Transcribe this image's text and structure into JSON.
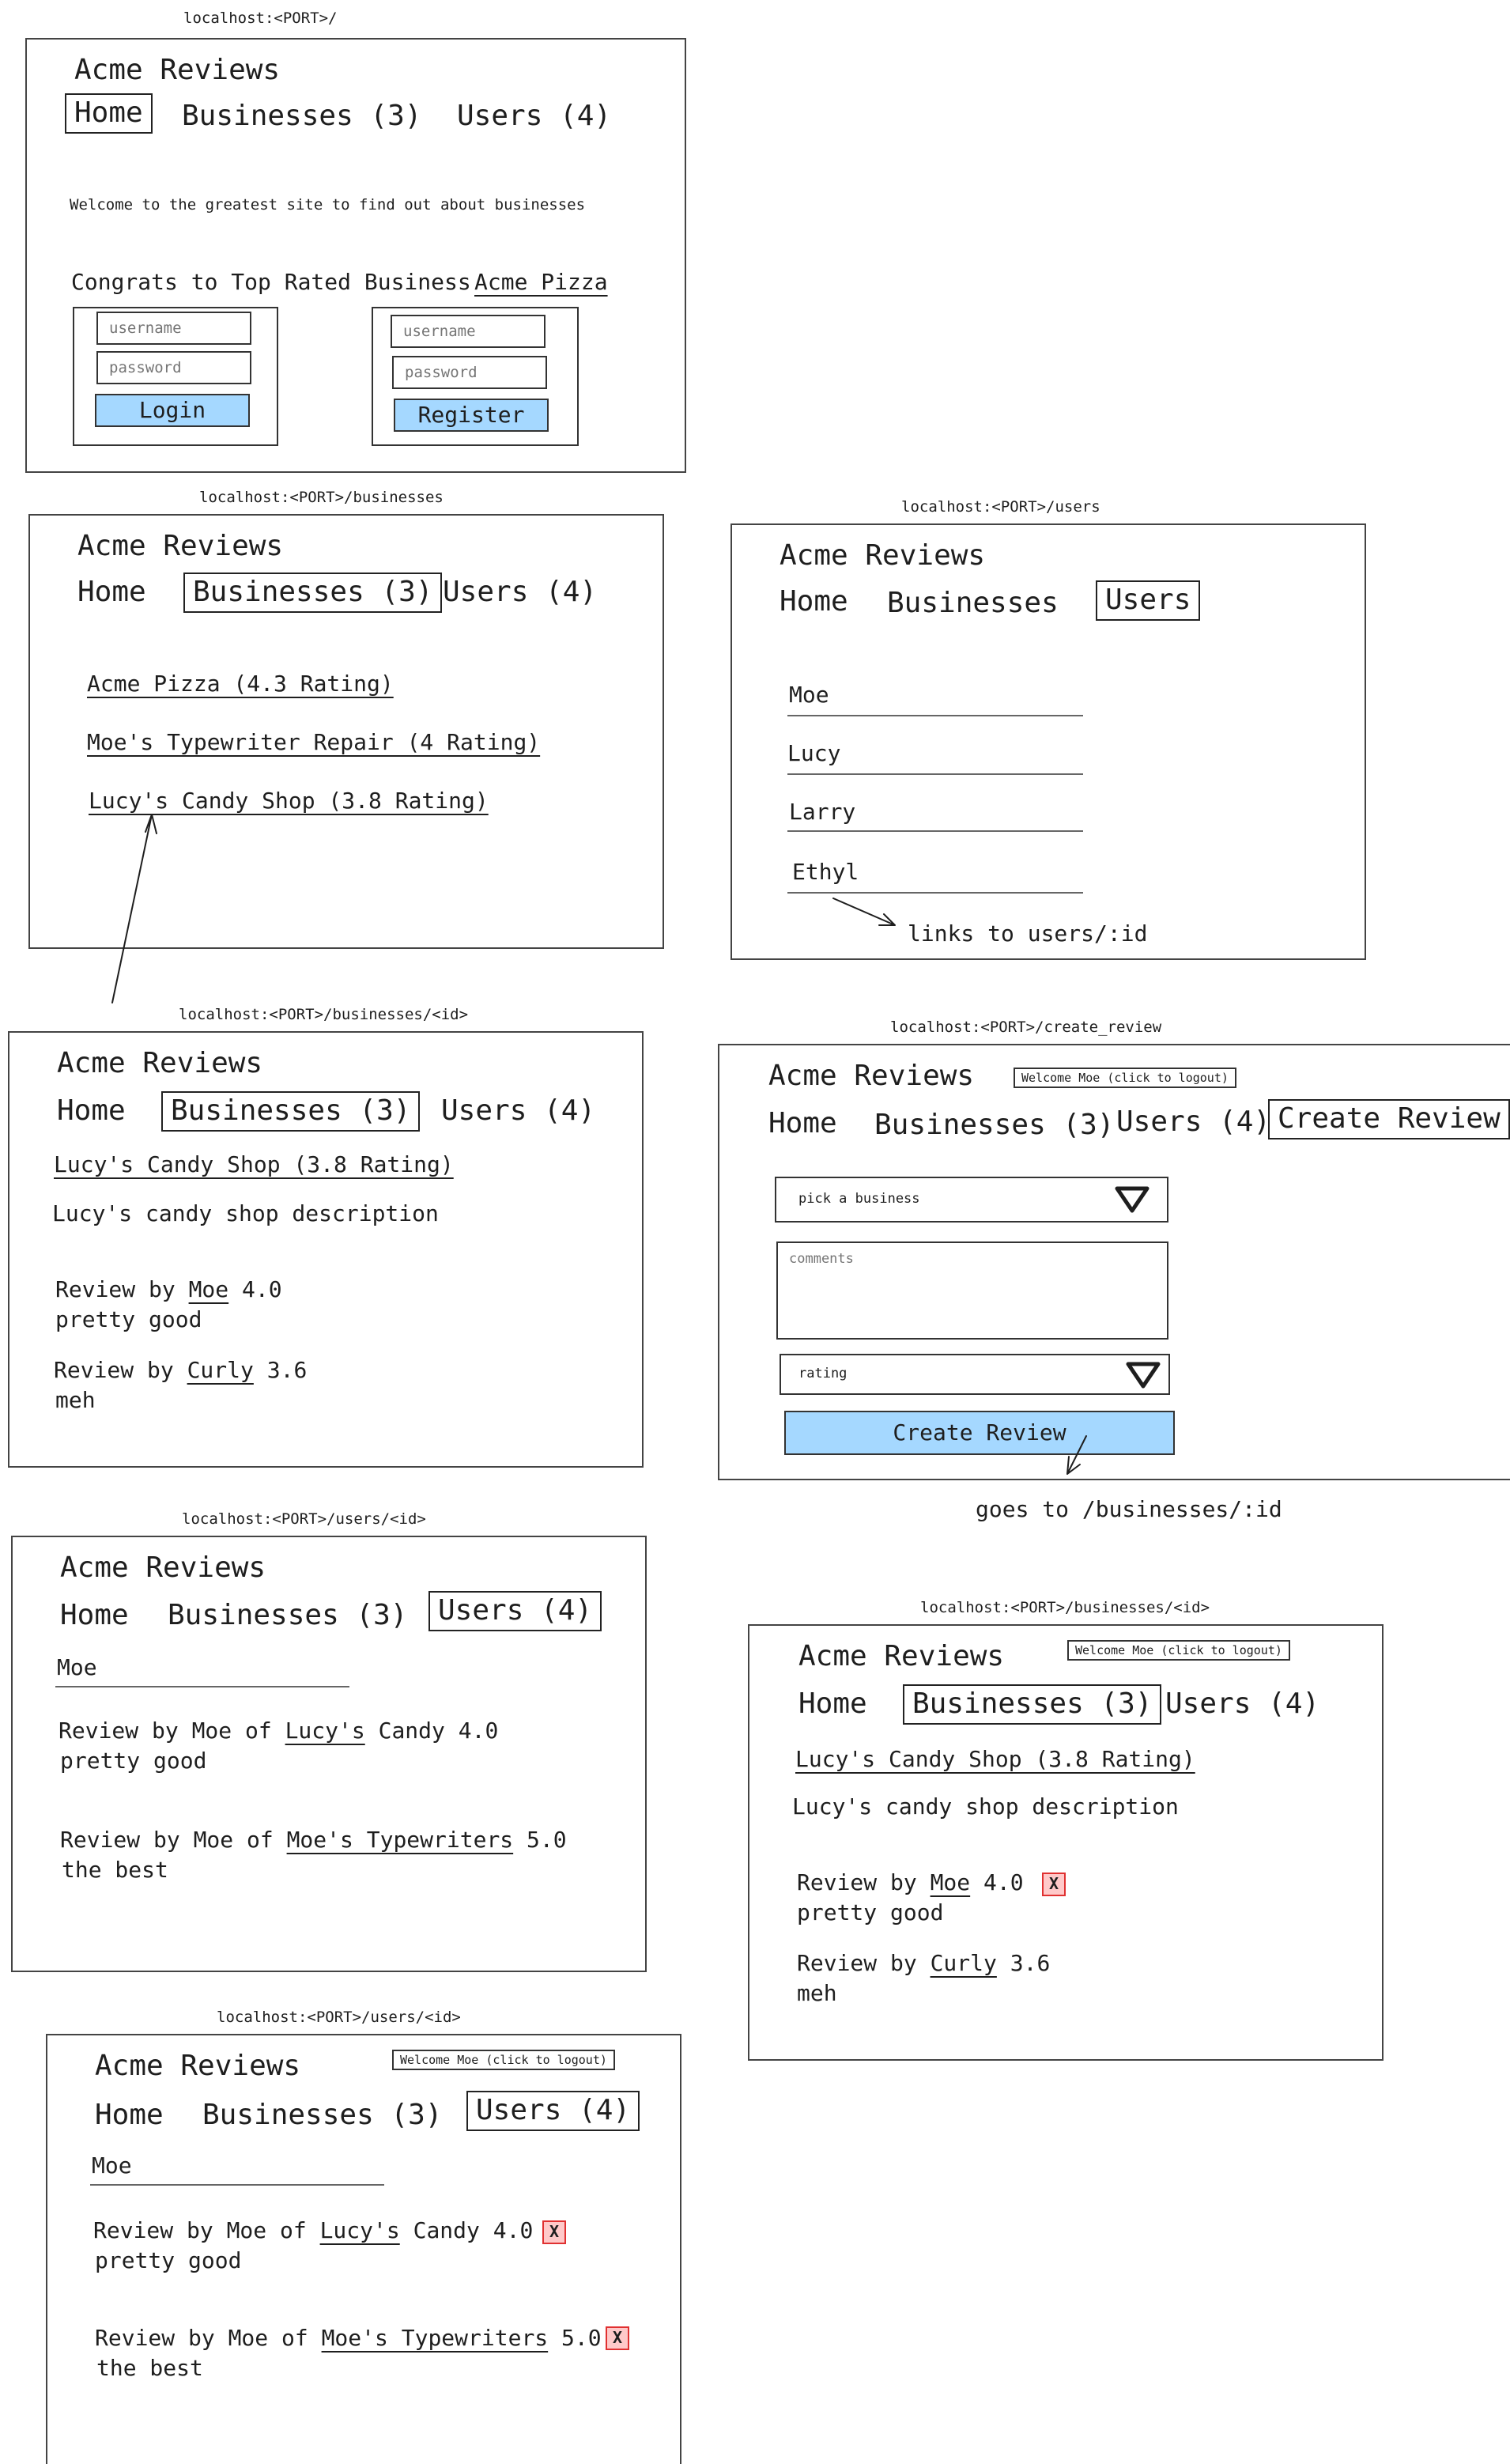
{
  "screens": {
    "home": {
      "url": "localhost:<PORT>/",
      "title": "Acme Reviews",
      "nav": [
        "Home",
        "Businesses (3)",
        "Users (4)"
      ],
      "welcome_text": "Welcome to the greatest site to find out about businesses",
      "congrats_prefix": "Congrats to Top Rated Business",
      "top_business": "Acme Pizza",
      "login": {
        "username_placeholder": "username",
        "password_placeholder": "password",
        "button": "Login"
      },
      "register": {
        "username_placeholder": "username",
        "password_placeholder": "password",
        "button": "Register"
      }
    },
    "businesses": {
      "url": "localhost:<PORT>/businesses",
      "title": "Acme Reviews",
      "nav": [
        "Home",
        "Businesses (3)",
        "Users (4)"
      ],
      "items": [
        "Acme Pizza (4.3 Rating)",
        "Moe's Typewriter Repair (4 Rating)",
        "Lucy's Candy Shop (3.8 Rating)"
      ]
    },
    "users": {
      "url": "localhost:<PORT>/users",
      "title": "Acme Reviews",
      "nav": [
        "Home",
        "Businesses",
        "Users"
      ],
      "items": [
        "Moe",
        "Lucy",
        "Larry",
        "Ethyl"
      ],
      "annotation": "links to users/:id"
    },
    "business_detail": {
      "url": "localhost:<PORT>/businesses/<id>",
      "title": "Acme Reviews",
      "nav": [
        "Home",
        "Businesses (3)",
        "Users (4)"
      ],
      "heading": "Lucy's Candy Shop (3.8 Rating)",
      "description": "Lucy's candy shop description",
      "reviews": [
        {
          "prefix": "Review by",
          "user": "Moe",
          "score": "4.0",
          "comment": "pretty good"
        },
        {
          "prefix": "Review by",
          "user": "Curly",
          "score": "3.6",
          "comment": "meh"
        }
      ]
    },
    "create_review": {
      "url": "localhost:<PORT>/create_review",
      "title": "Acme Reviews",
      "welcome": "Welcome Moe (click to logout)",
      "nav": [
        "Home",
        "Businesses (3)",
        "Users (4)",
        "Create Review"
      ],
      "business_select": "pick a business",
      "comments_placeholder": "comments",
      "rating_select": "rating",
      "button": "Create Review",
      "annotation": "goes to /businesses/:id"
    },
    "user_detail": {
      "url": "localhost:<PORT>/users/<id>",
      "title": "Acme Reviews",
      "nav": [
        "Home",
        "Businesses (3)",
        "Users (4)"
      ],
      "name": "Moe",
      "reviews": [
        {
          "prefix": "Review by Moe of",
          "business": "Lucy's",
          "suffix": "Candy 4.0",
          "comment": "pretty good"
        },
        {
          "prefix": "Review by Moe of",
          "business": "Moe's Typewriters",
          "suffix": "5.0",
          "comment": "the best"
        }
      ]
    },
    "business_detail_logged_in": {
      "url": "localhost:<PORT>/businesses/<id>",
      "title": "Acme Reviews",
      "welcome": "Welcome Moe (click to logout)",
      "nav": [
        "Home",
        "Businesses (3)",
        "Users (4)"
      ],
      "heading": "Lucy's Candy Shop (3.8 Rating)",
      "description": "Lucy's candy shop description",
      "reviews": [
        {
          "prefix": "Review by",
          "user": "Moe",
          "score": "4.0",
          "comment": "pretty good",
          "delete": "X"
        },
        {
          "prefix": "Review by",
          "user": "Curly",
          "score": "3.6",
          "comment": "meh"
        }
      ]
    },
    "user_detail_logged_in": {
      "url": "localhost:<PORT>/users/<id>",
      "title": "Acme Reviews",
      "welcome": "Welcome Moe (click to logout)",
      "nav": [
        "Home",
        "Businesses (3)",
        "Users (4)"
      ],
      "name": "Moe",
      "reviews": [
        {
          "prefix": "Review by Moe of",
          "business": "Lucy's",
          "suffix": "Candy 4.0",
          "comment": "pretty good",
          "delete": "X"
        },
        {
          "prefix": "Review by Moe of",
          "business": "Moe's Typewriters",
          "suffix": "5.0",
          "comment": "the best",
          "delete": "X"
        }
      ]
    }
  },
  "colors": {
    "button_fill": "#a5d8ff",
    "delete_fill": "#ffc9c9",
    "delete_border": "#e03131",
    "stroke": "#1e1e1e"
  }
}
